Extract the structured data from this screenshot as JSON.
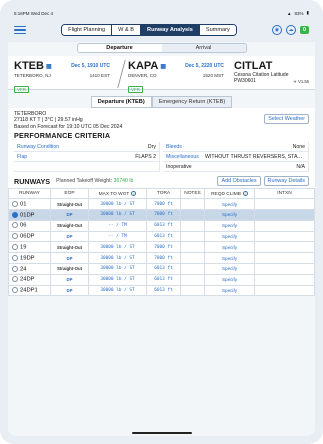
{
  "status": {
    "time": "5:16PM",
    "day": "Wed Dec 4",
    "battery": "83%"
  },
  "nav_tabs": [
    "Flight Planning",
    "W & B",
    "Runway Analysis",
    "Summary"
  ],
  "badge": "0",
  "sub_tabs": [
    "Departure",
    "Arrival"
  ],
  "route": {
    "from": {
      "code": "KTEB",
      "date": "Dec 5, 1910 UTC",
      "city": "TETERBORO, NJ",
      "local": "1410 EST",
      "rules": "VFR"
    },
    "to": {
      "code": "KAPA",
      "date": "Dec 5, 2220 UTC",
      "city": "DENVER, CO",
      "local": "1520 MST",
      "rules": "VFR"
    },
    "aircraft": {
      "code": "CITLAT",
      "name": "Cessna Citation Latitude",
      "reg": "PW30601"
    },
    "version": "V1.55"
  },
  "dep_tabs": [
    "Departure (KTEB)",
    "Emergency Return (KTEB)"
  ],
  "weather": {
    "line1": "TETERBORO",
    "line2": "27118 KT T | 3°C | 29.57 inHg",
    "line3": "Based on Forecast for 19:10 UTC 05 Dec 2024",
    "button": "Select Weather"
  },
  "performance": {
    "title": "PERFORMANCE CRITERIA",
    "items": [
      {
        "k": "Runway Condition",
        "v": "Dry"
      },
      {
        "k": "Bleeds",
        "v": "None"
      },
      {
        "k": "Flap",
        "v": "FLAPS 2"
      },
      {
        "k": "Miscellaneous",
        "v": "WITHOUT THRUST REVERSERS, STATI..."
      },
      {
        "k": "",
        "v": ""
      },
      {
        "k": "Inoperative",
        "v": "N/A"
      }
    ]
  },
  "runways": {
    "title": "RUNWAYS",
    "ptw_label": "Planned Takeoff Weight:",
    "ptw_value": "36740 lb",
    "buttons": [
      "Add Obstacles",
      "Runway Details"
    ],
    "columns": [
      "RUNWAY",
      "EOP",
      "MAX TO WGT",
      "TORA",
      "NOTES",
      "REQD CLIMB",
      "INTXN"
    ],
    "rows": [
      {
        "rwy": "01",
        "eop": "Straight-Out",
        "mtow": "30000 lb / ST",
        "tora": "7000 ft",
        "notes": "",
        "climb": "Specify",
        "intxn": "",
        "selected": false,
        "dp": false
      },
      {
        "rwy": "01DP",
        "eop": "DP",
        "mtow": "30000 lb / ST",
        "tora": "7000 ft",
        "notes": "",
        "climb": "Specify",
        "intxn": "",
        "selected": true,
        "dp": true
      },
      {
        "rwy": "06",
        "eop": "Straight-Out",
        "mtow": "-- / TM",
        "tora": "6013 ft",
        "notes": "",
        "climb": "Specify",
        "intxn": "",
        "selected": false,
        "dp": false
      },
      {
        "rwy": "06DP",
        "eop": "DP",
        "mtow": "-- / TM",
        "tora": "6013 ft",
        "notes": "",
        "climb": "Specify",
        "intxn": "",
        "selected": false,
        "dp": true
      },
      {
        "rwy": "19",
        "eop": "Straight-Out",
        "mtow": "30000 lb / ST",
        "tora": "7000 ft",
        "notes": "",
        "climb": "Specify",
        "intxn": "",
        "selected": false,
        "dp": false
      },
      {
        "rwy": "19DP",
        "eop": "DP",
        "mtow": "30000 lb / ST",
        "tora": "7000 ft",
        "notes": "",
        "climb": "Specify",
        "intxn": "",
        "selected": false,
        "dp": true
      },
      {
        "rwy": "24",
        "eop": "Straight-Out",
        "mtow": "30000 lb / ST",
        "tora": "6013 ft",
        "notes": "",
        "climb": "Specify",
        "intxn": "",
        "selected": false,
        "dp": false
      },
      {
        "rwy": "24DP",
        "eop": "DP",
        "mtow": "30000 lb / ST",
        "tora": "6013 ft",
        "notes": "",
        "climb": "Specify",
        "intxn": "",
        "selected": false,
        "dp": true
      },
      {
        "rwy": "24DP1",
        "eop": "DP",
        "mtow": "30000 lb / ST",
        "tora": "6013 ft",
        "notes": "",
        "climb": "Specify",
        "intxn": "",
        "selected": false,
        "dp": true
      }
    ]
  }
}
